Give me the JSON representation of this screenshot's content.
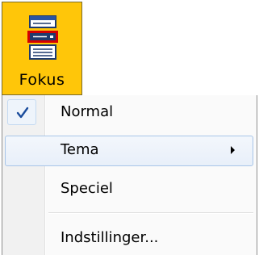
{
  "ribbon_button": {
    "label": "Fokus",
    "icon": "document-printer-icon",
    "background_color": "#ffc609"
  },
  "menu": {
    "items": [
      {
        "label": "Normal",
        "checked": true,
        "has_submenu": false
      },
      {
        "label": "Tema",
        "checked": false,
        "has_submenu": true,
        "hovered": true
      },
      {
        "label": "Speciel",
        "checked": false,
        "has_submenu": false
      },
      {
        "label": "Indstillinger...",
        "checked": false,
        "has_submenu": false
      }
    ],
    "check_icon": "checkmark-icon",
    "submenu_icon": "triangle-right-icon",
    "hover_border_color": "#a8c5e8",
    "check_color": "#1a4c9c"
  }
}
